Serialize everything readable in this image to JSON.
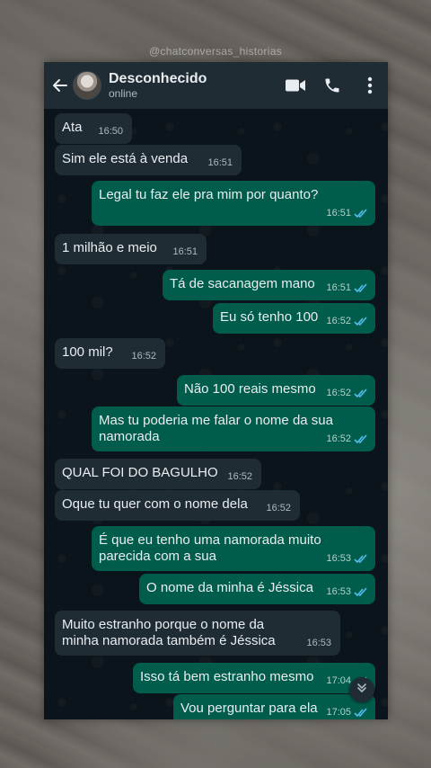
{
  "watermark": "@chatconversas_historias",
  "header": {
    "contact_name": "Desconhecido",
    "status": "online",
    "icons": [
      "back-arrow-icon",
      "video-call-icon",
      "phone-call-icon",
      "menu-dots-icon"
    ]
  },
  "messages": [
    {
      "dir": "in",
      "text": "Ata",
      "time": "16:50"
    },
    {
      "dir": "in",
      "text": "Sim ele está à venda",
      "time": "16:51"
    },
    {
      "dir": "out",
      "text": "Legal tu faz ele pra mim por quanto?",
      "time": "16:51",
      "status": "read"
    },
    {
      "dir": "in",
      "text": "1 milhão e meio",
      "time": "16:51"
    },
    {
      "dir": "out",
      "text": "Tá de sacanagem mano",
      "time": "16:51",
      "status": "read"
    },
    {
      "dir": "out",
      "text": "Eu só tenho 100",
      "time": "16:52",
      "status": "read"
    },
    {
      "dir": "in",
      "text": "100 mil?",
      "time": "16:52"
    },
    {
      "dir": "out",
      "text": "Não 100 reais mesmo",
      "time": "16:52",
      "status": "read"
    },
    {
      "dir": "out",
      "text": "Mas tu poderia me falar o nome da sua namorada",
      "time": "16:52",
      "status": "read"
    },
    {
      "dir": "in",
      "text": "QUAL FOI DO BAGULHO",
      "time": "16:52"
    },
    {
      "dir": "in",
      "text": "Oque tu quer com o nome dela",
      "time": "16:52"
    },
    {
      "dir": "out",
      "text": "É que eu tenho uma namorada muito parecida com a sua",
      "time": "16:53",
      "status": "read"
    },
    {
      "dir": "out",
      "text": "O nome da minha é Jéssica",
      "time": "16:53",
      "status": "read"
    },
    {
      "dir": "in",
      "text": "Muito estranho porque o nome da minha namorada também é Jéssica",
      "time": "16:53"
    },
    {
      "dir": "out",
      "text": "Isso tá bem estranho mesmo",
      "time": "17:04",
      "status": "read"
    },
    {
      "dir": "out",
      "text": "Vou perguntar para ela",
      "time": "17:05",
      "status": "read"
    }
  ],
  "colors": {
    "header_bg": "#1f2c34",
    "chat_bg": "#0b141a",
    "incoming_bubble": "#1f2c34",
    "outgoing_bubble": "#005c4b",
    "read_tick": "#53bdeb"
  }
}
